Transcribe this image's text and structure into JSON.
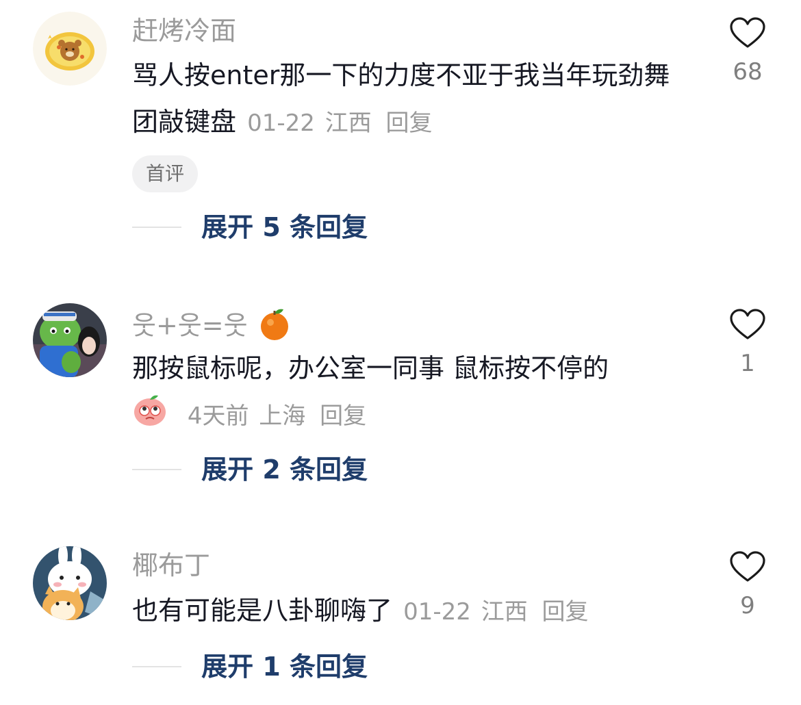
{
  "comments": [
    {
      "username": "赶烤冷面",
      "text": "骂人按enter那一下的力度不亚于我当年玩劲舞团敲键盘",
      "date": "01-22",
      "location": "江西",
      "reply_label": "回复",
      "badge": "首评",
      "expand_label": "展开 5 条回复",
      "likes": "68",
      "avatar_icon": "bear-in-egg-avatar"
    },
    {
      "username": "웃+웃=웃",
      "username_emoji": "tangerine-icon",
      "text": "那按鼠标呢，办公室一同事 鼠标按不停的",
      "emoji": "peach-rolling-eyes-icon",
      "date": "4天前",
      "location": "上海",
      "reply_label": "回复",
      "expand_label": "展开 2 条回复",
      "likes": "1",
      "avatar_icon": "green-mascot-photo-avatar"
    },
    {
      "username": "椰布丁",
      "text": "也有可能是八卦聊嗨了",
      "date": "01-22",
      "location": "江西",
      "reply_label": "回复",
      "expand_label": "展开 1 条回复",
      "likes": "9",
      "avatar_icon": "bunny-and-puppy-avatar"
    }
  ],
  "colors": {
    "name": "#9a9a9a",
    "text": "#161823",
    "meta": "#9b9b9b",
    "expand": "#1f3d6b",
    "badge_bg": "#f1f1f2"
  }
}
